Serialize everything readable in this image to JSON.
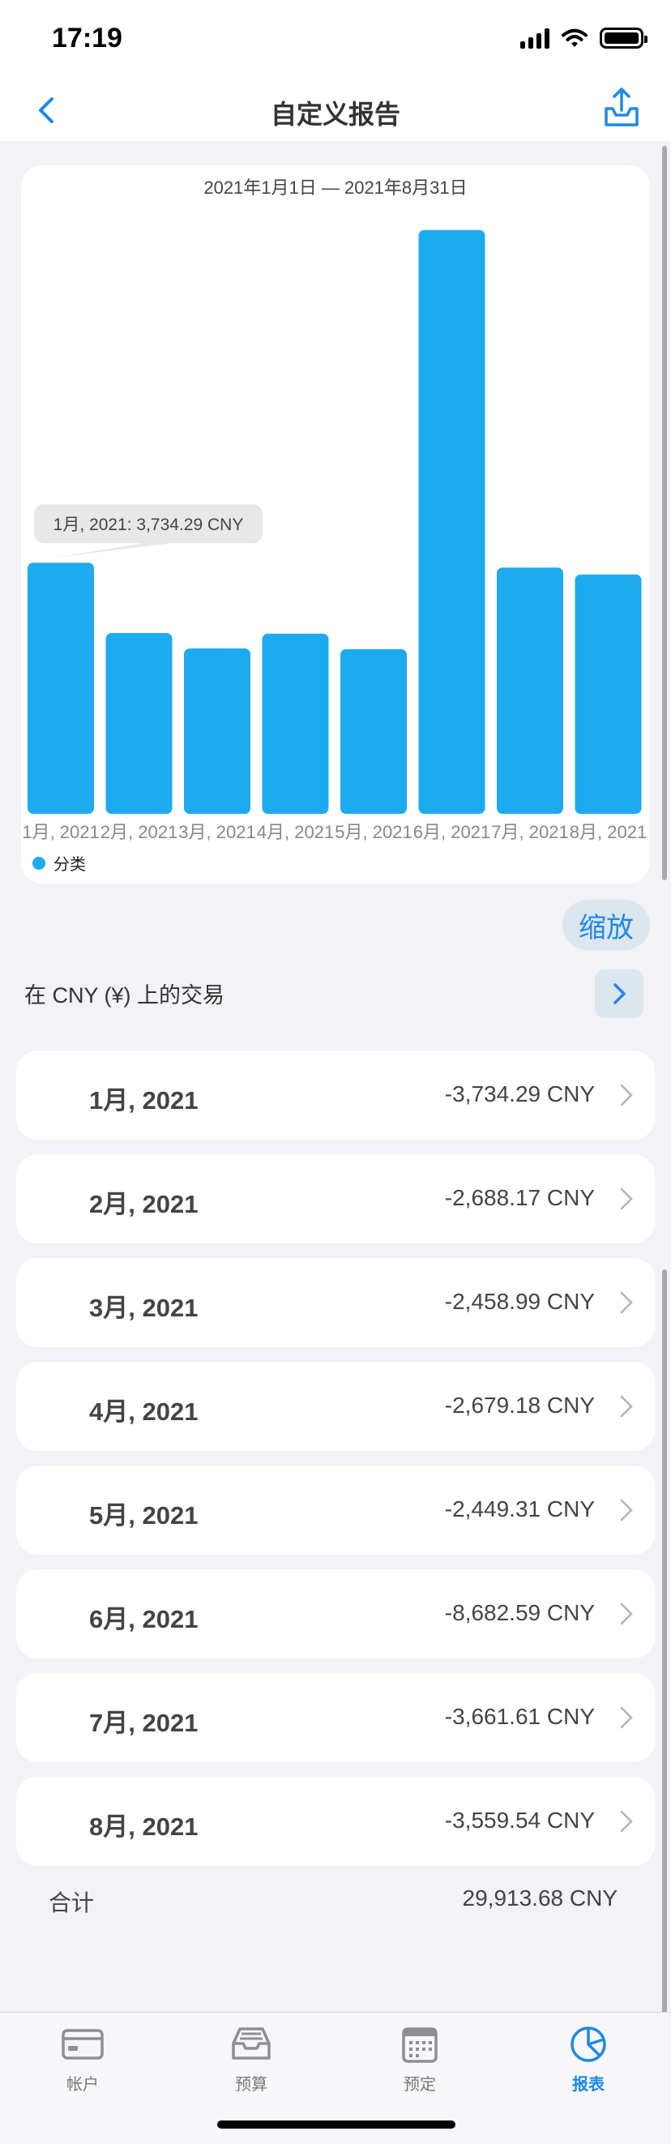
{
  "status_bar": {
    "time": "17:19"
  },
  "nav": {
    "title": "自定义报告",
    "back_icon": "chevron-left-icon",
    "share_icon": "share-tray-icon"
  },
  "chart": {
    "date_range": "2021年1月1日 — 2021年8月31日",
    "tooltip": "1月, 2021: 3,734.29 CNY",
    "legend": "分类",
    "zoom_label": "缩放"
  },
  "chart_data": {
    "type": "bar",
    "title": "2021年1月1日 — 2021年8月31日",
    "categories": [
      "1月, 2021",
      "2月, 2021",
      "3月, 2021",
      "4月, 2021",
      "5月, 2021",
      "6月, 2021",
      "7月, 2021",
      "8月, 2021"
    ],
    "series": [
      {
        "name": "分类",
        "values": [
          3734.29,
          2688.17,
          2458.99,
          2679.18,
          2449.31,
          8682.59,
          3661.61,
          3559.54
        ],
        "color": "#1eaaf1"
      }
    ],
    "legend": "bottom-left",
    "grid": false,
    "ylim": [
      0,
      8800
    ]
  },
  "section": {
    "label": "在 CNY (¥) 上的交易"
  },
  "rows": [
    {
      "month": "1月, 2021",
      "amount": "-3,734.29 CNY"
    },
    {
      "month": "2月, 2021",
      "amount": "-2,688.17 CNY"
    },
    {
      "month": "3月, 2021",
      "amount": "-2,458.99 CNY"
    },
    {
      "month": "4月, 2021",
      "amount": "-2,679.18 CNY"
    },
    {
      "month": "5月, 2021",
      "amount": "-2,449.31 CNY"
    },
    {
      "month": "6月, 2021",
      "amount": "-8,682.59 CNY"
    },
    {
      "month": "7月, 2021",
      "amount": "-3,661.61 CNY"
    },
    {
      "month": "8月, 2021",
      "amount": "-3,559.54 CNY"
    }
  ],
  "total": {
    "label": "合计",
    "value": "29,913.68 CNY"
  },
  "tabs": [
    {
      "label": "帐户",
      "icon": "credit-card-icon",
      "active": false
    },
    {
      "label": "预算",
      "icon": "inbox-tray-icon",
      "active": false
    },
    {
      "label": "预定",
      "icon": "calendar-icon",
      "active": false
    },
    {
      "label": "报表",
      "icon": "pie-chart-icon",
      "active": true
    }
  ],
  "colors": {
    "accent": "#1e88e5",
    "bar": "#1eaaf1"
  }
}
